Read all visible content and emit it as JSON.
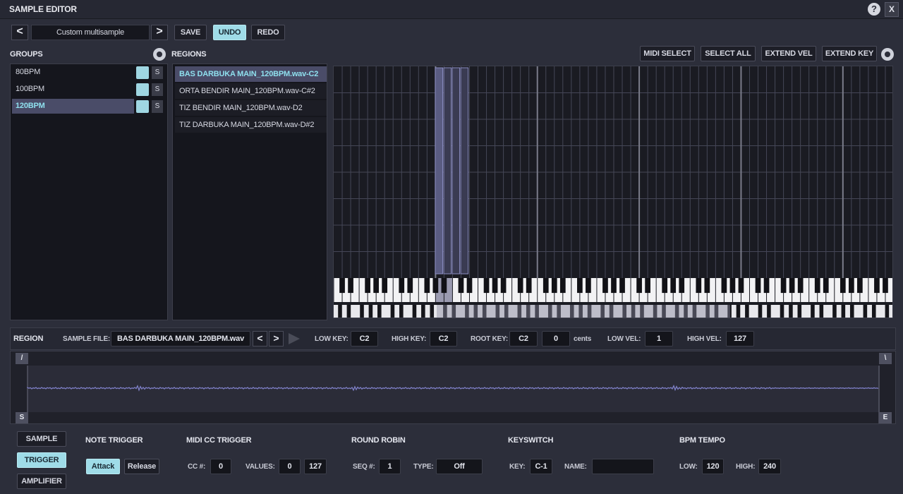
{
  "window": {
    "title": "SAMPLE EDITOR",
    "help_label": "?",
    "close_label": "X"
  },
  "toolbar": {
    "prev_label": "<",
    "preset_name": "Custom multisample",
    "next_label": ">",
    "save_label": "SAVE",
    "undo_label": "UNDO",
    "redo_label": "REDO"
  },
  "groups": {
    "heading": "GROUPS",
    "solo_label": "S",
    "items": [
      {
        "label": "80BPM",
        "selected": false
      },
      {
        "label": "100BPM",
        "selected": false
      },
      {
        "label": "120BPM",
        "selected": true
      }
    ]
  },
  "regions": {
    "heading": "REGIONS",
    "items": [
      {
        "label": "BAS DARBUKA MAIN_120BPM.wav-C2",
        "selected": true
      },
      {
        "label": "ORTA BENDIR MAIN_120BPM.wav-C#2",
        "selected": false
      },
      {
        "label": "TIZ BENDIR MAIN_120BPM.wav-D2",
        "selected": false
      },
      {
        "label": "TIZ DARBUKA MAIN_120BPM.wav-D#2",
        "selected": false
      }
    ]
  },
  "mapping_toolbar": {
    "midi_select_label": "MIDI SELECT",
    "select_all_label": "SELECT ALL",
    "extend_vel_label": "EXTEND VEL",
    "extend_key_label": "EXTEND KEY"
  },
  "region": {
    "heading": "REGION",
    "sample_file_label": "SAMPLE FILE:",
    "sample_file": "BAS DARBUKA MAIN_120BPM.wav",
    "prev_label": "<",
    "next_label": ">",
    "low_key_label": "LOW KEY:",
    "low_key": "C2",
    "high_key_label": "HIGH KEY:",
    "high_key": "C2",
    "root_key_label": "ROOT KEY:",
    "root_key": "C2",
    "cents": "0",
    "cents_label": "cents",
    "low_vel_label": "LOW VEL:",
    "low_vel": "1",
    "high_vel_label": "HIGH VEL:",
    "high_vel": "127"
  },
  "waveform": {
    "fade_in_label": "/",
    "fade_out_label": "\\",
    "start_label": "S",
    "end_label": "E",
    "color": "#7f80c8"
  },
  "bottom_tabs": {
    "sample_label": "SAMPLE",
    "trigger_label": "TRIGGER",
    "amplifier_label": "AMPLIFIER"
  },
  "note_trigger": {
    "heading": "NOTE TRIGGER",
    "attack_label": "Attack",
    "release_label": "Release"
  },
  "midi_cc_trigger": {
    "heading": "MIDI CC TRIGGER",
    "cc_label": "CC #:",
    "cc_value": "0",
    "values_label": "VALUES:",
    "low_value": "0",
    "high_value": "127"
  },
  "round_robin": {
    "heading": "ROUND ROBIN",
    "seq_label": "SEQ #:",
    "seq_value": "1",
    "type_label": "TYPE:",
    "type_value": "Off"
  },
  "keyswitch": {
    "heading": "KEYSWITCH",
    "key_label": "KEY:",
    "key_value": "C-1",
    "name_label": "NAME:",
    "name_value": ""
  },
  "bpm_tempo": {
    "heading": "BPM TEMPO",
    "low_label": "LOW:",
    "low_value": "120",
    "high_label": "HIGH:",
    "high_value": "240"
  },
  "colors": {
    "accent": "#9fdce8",
    "selected_row": "#4a4c68",
    "background": "#2c2e3a"
  }
}
